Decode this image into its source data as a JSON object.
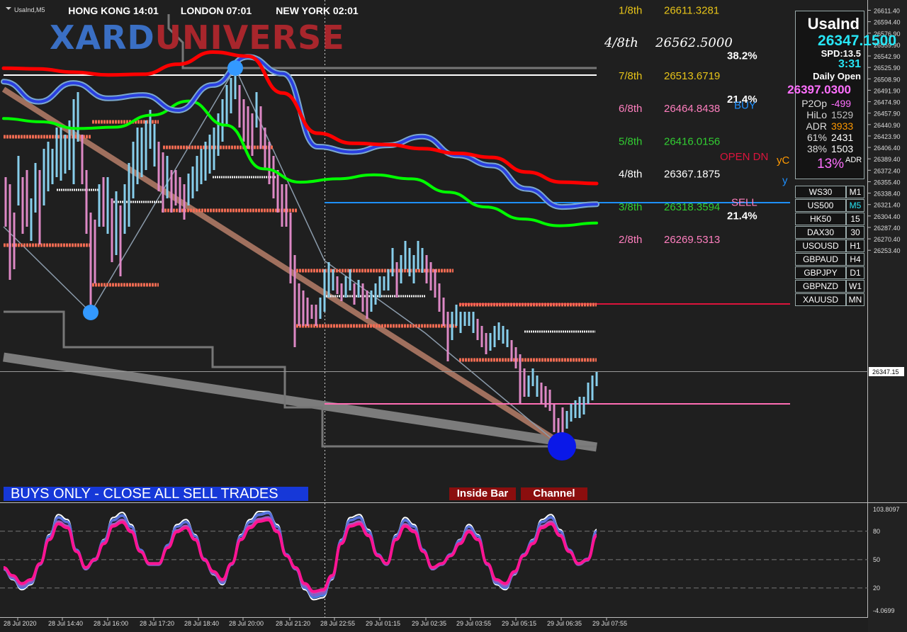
{
  "window": {
    "symbol_title": "UsaInd,M5"
  },
  "sessions": [
    {
      "label": "HONG KONG  14:01",
      "bg": "#1565c0"
    },
    {
      "label": "LONDON  07:01",
      "bg": "#8b1a1a"
    },
    {
      "label": "NEW YORK  02:01",
      "bg": "#8b1a1a"
    }
  ],
  "logo": {
    "part1": "XARD",
    "part2": "UNIVERSE",
    "color1": "#3a6fc4",
    "color2": "#b22222"
  },
  "info_panel": {
    "symbol": "UsaInd",
    "price": "26347.1500",
    "spread": "SPD:13.5",
    "timer": "3:31",
    "daily_open_label": "Daily Open",
    "daily_open": "26397.0300",
    "rows": [
      {
        "label": "P2Op",
        "value": "-499",
        "color": "#ff70ff"
      },
      {
        "label": "HiLo",
        "value": "1529",
        "color": "#c0c0c0"
      },
      {
        "label": "ADR",
        "value": "3933",
        "color": "#ff9900"
      },
      {
        "label": "61%",
        "value": "2431",
        "color": "#ffffff"
      },
      {
        "label": "38%",
        "value": "1503",
        "color": "#ffffff"
      }
    ],
    "adr_pct": "13%",
    "adr_suffix": "ADR"
  },
  "symbols": [
    {
      "symbol": "WS30",
      "tf": "M1"
    },
    {
      "symbol": "US500",
      "tf": "M5"
    },
    {
      "symbol": "HK50",
      "tf": "15"
    },
    {
      "symbol": "DAX30",
      "tf": "30"
    },
    {
      "symbol": "USOUSD",
      "tf": "H1"
    },
    {
      "symbol": "GBPAUD",
      "tf": "H4"
    },
    {
      "symbol": "GBPJPY",
      "tf": "D1"
    },
    {
      "symbol": "GBPNZD",
      "tf": "W1"
    },
    {
      "symbol": "XAUUSD",
      "tf": "MN"
    }
  ],
  "murrey": [
    {
      "name": "1/8th",
      "value": "26611.3281",
      "color": "#e6c319",
      "price": 26611.33
    },
    {
      "name": "4/8th",
      "value": "26562.5000",
      "color": "#ffffff",
      "price": 26562.5,
      "special": true
    },
    {
      "name": "7/8th",
      "value": "26513.6719",
      "color": "#e6c319",
      "price": 26513.67
    },
    {
      "name": "6/8th",
      "value": "26464.8438",
      "color": "#ff7fbf",
      "price": 26464.84
    },
    {
      "name": "5/8th",
      "value": "26416.0156",
      "color": "#32cd32",
      "price": 26416.02
    },
    {
      "name": "4/8th",
      "value": "26367.1875",
      "color": "#ffffff",
      "price": 26367.19
    },
    {
      "name": "3/8th",
      "value": "26318.3594",
      "color": "#32cd32",
      "price": 26318.36
    },
    {
      "name": "2/8th",
      "value": "26269.5313",
      "color": "#ff7fbf",
      "price": 26269.53
    }
  ],
  "fib_labels": [
    {
      "text": "38.2%",
      "price": 26544
    },
    {
      "text": "21.4%",
      "price": 26479
    },
    {
      "text": "21.4%",
      "price": 26305
    }
  ],
  "level_labels": [
    {
      "text": "BUY",
      "price": 26470,
      "color": "#1e90ff"
    },
    {
      "text": "OPEN DN",
      "price": 26393,
      "color": "#dc143c"
    },
    {
      "text": "yC",
      "price": 26388,
      "color": "#ff9900"
    },
    {
      "text": "y",
      "price": 26358,
      "color": "#1e90ff"
    },
    {
      "text": "SELL",
      "price": 26325,
      "color": "#ff7fbf"
    }
  ],
  "banner": "BUYS ONLY - CLOSE ALL SELL TRADES",
  "tags": [
    "Inside Bar",
    "Channel"
  ],
  "current_price_tag": "26347.15",
  "chart_data": {
    "type": "line",
    "price_axis": {
      "ticks": [
        "26611.40",
        "26594.40",
        "26576.90",
        "26559.90",
        "26542.90",
        "26525.90",
        "26508.90",
        "26491.90",
        "26474.90",
        "26457.90",
        "26440.90",
        "26423.90",
        "26406.40",
        "26389.40",
        "26372.40",
        "26355.40",
        "26338.40",
        "26321.40",
        "26304.40",
        "26287.40",
        "26270.40",
        "26253.40"
      ],
      "ylim": [
        26253.4,
        26611.4
      ]
    },
    "time_axis": [
      "28 Jul 2020",
      "28 Jul 14:40",
      "28 Jul 16:00",
      "28 Jul 17:20",
      "28 Jul 18:40",
      "28 Jul 20:00",
      "28 Jul 21:20",
      "28 Jul 22:55",
      "29 Jul 01:15",
      "29 Jul 02:35",
      "29 Jul 03:55",
      "29 Jul 05:15",
      "29 Jul 06:35",
      "29 Jul 07:55"
    ],
    "oscillator": {
      "ticks": [
        "103.8097",
        "80",
        "50",
        "20",
        "-4.0699"
      ],
      "levels": [
        80,
        50,
        20
      ],
      "ylim": [
        -4.07,
        103.81
      ]
    },
    "series": [
      {
        "color": "#ff0000",
        "values": [
          26525,
          26524,
          26519,
          26515,
          26516,
          26531,
          26549,
          26543,
          26488,
          26428,
          26413,
          26411,
          26405,
          26398,
          26392,
          26370,
          26355,
          26353
        ]
      },
      {
        "color": "#2a3fe0",
        "values": [
          26505,
          26475,
          26503,
          26480,
          26485,
          26462,
          26500,
          26542,
          26517,
          26408,
          26400,
          26410,
          26423,
          26395,
          26380,
          26345,
          26318,
          26322
        ]
      },
      {
        "color": "#00ff00",
        "values": [
          26450,
          26445,
          26435,
          26437,
          26455,
          26476,
          26440,
          26375,
          26355,
          26360,
          26366,
          26360,
          26340,
          26318,
          26300,
          26290,
          26294
        ]
      }
    ]
  }
}
